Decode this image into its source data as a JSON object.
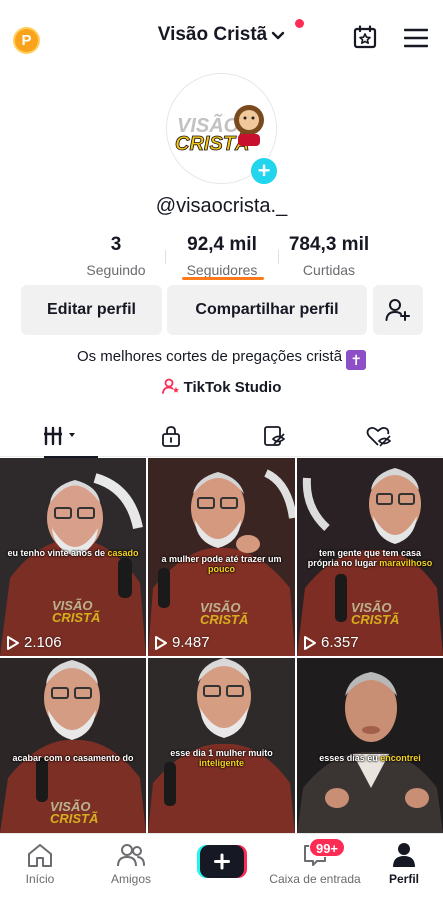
{
  "header": {
    "coin_letter": "P",
    "title": "Visão Cristã"
  },
  "profile": {
    "avatar_line1": "VISÃO",
    "avatar_line2": "CRISTÃ",
    "username": "@visaocrista._",
    "stats": [
      {
        "value": "3",
        "label": "Seguindo"
      },
      {
        "value": "92,4 mil",
        "label": "Seguidores"
      },
      {
        "value": "784,3 mil",
        "label": "Curtidas"
      }
    ],
    "buttons": {
      "edit": "Editar perfil",
      "share": "Compartilhar perfil"
    },
    "bio": "Os melhores cortes de pregações cristã",
    "bio_emoji": "✝",
    "studio_link": "TikTok Studio"
  },
  "videos": [
    {
      "caption_a": "eu tenho vinte anos de ",
      "caption_b": "casado",
      "views": "2.106"
    },
    {
      "caption_a": "a mulher pode até trazer um ",
      "caption_b": "pouco",
      "views": "9.487"
    },
    {
      "caption_a": "tem gente que tem casa própria no lugar ",
      "caption_b": "maravilhoso",
      "views": "6.357"
    },
    {
      "caption_a": "acabar com o casamento do",
      "caption_b": "",
      "views": ""
    },
    {
      "caption_a": "esse dia 1 mulher muito ",
      "caption_b": "inteligente",
      "views": ""
    },
    {
      "caption_a": "esses dias eu ",
      "caption_b": "encontrei",
      "views": ""
    }
  ],
  "watermark": {
    "line1": "VISÃO",
    "line2": "CRISTÃ"
  },
  "nav": {
    "home": "Início",
    "friends": "Amigos",
    "inbox": "Caixa de entrada",
    "inbox_badge": "99+",
    "profile": "Perfil"
  },
  "colors": {
    "accent_red": "#fe2c55",
    "accent_cyan": "#20d5ec",
    "followers_underline": "#ff7a1a",
    "text_primary": "#161823"
  }
}
